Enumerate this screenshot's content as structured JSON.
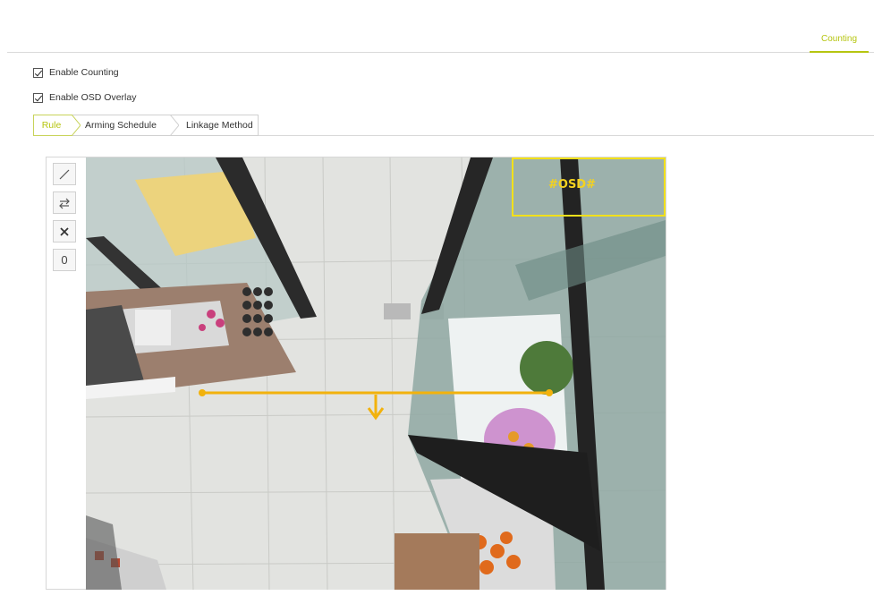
{
  "header": {
    "tabs": [
      {
        "label": "Counting",
        "active": true
      }
    ]
  },
  "options": {
    "enable_counting": {
      "label": "Enable Counting",
      "checked": true
    },
    "enable_osd": {
      "label": "Enable OSD Overlay",
      "checked": true
    }
  },
  "sub_tabs": [
    {
      "label": "Rule",
      "active": true
    },
    {
      "label": "Arming Schedule",
      "active": false
    },
    {
      "label": "Linkage Method",
      "active": false
    }
  ],
  "toolbar": {
    "tools": [
      {
        "icon": "draw-line-icon"
      },
      {
        "icon": "swap-direction-icon"
      },
      {
        "icon": "delete-icon"
      },
      {
        "icon": "reset-count-icon",
        "label": "0"
      }
    ]
  },
  "video": {
    "osd_text": "#OSD#",
    "accent_color": "#f2b20d",
    "osd_border_color": "#f2e01a"
  },
  "colors": {
    "accent": "#b6c510"
  }
}
